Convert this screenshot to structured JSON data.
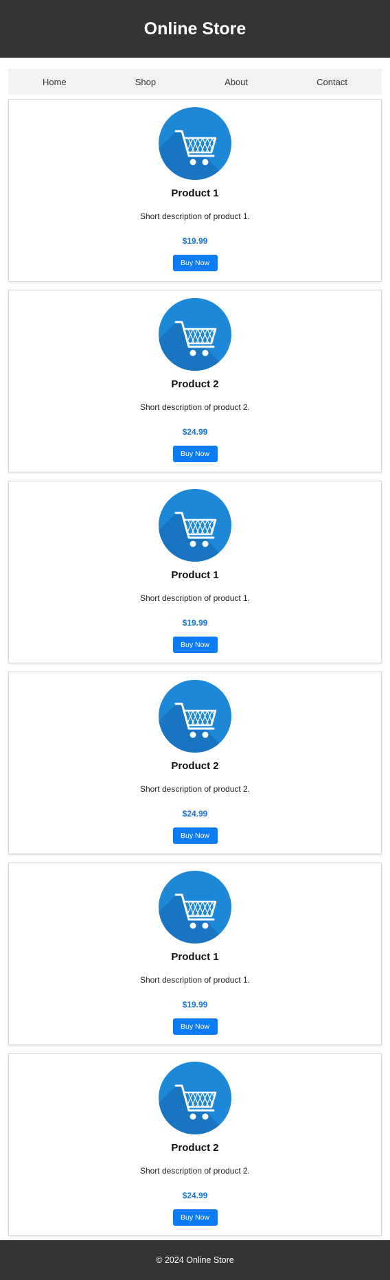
{
  "header": {
    "title": "Online Store"
  },
  "nav": {
    "items": [
      {
        "label": "Home"
      },
      {
        "label": "Shop"
      },
      {
        "label": "About"
      },
      {
        "label": "Contact"
      }
    ]
  },
  "products": [
    {
      "name": "Product 1",
      "description": "Short description of product 1.",
      "price": "$19.99",
      "button_label": "Buy Now",
      "icon": "shopping-cart-icon"
    },
    {
      "name": "Product 2",
      "description": "Short description of product 2.",
      "price": "$24.99",
      "button_label": "Buy Now",
      "icon": "shopping-cart-icon"
    },
    {
      "name": "Product 1",
      "description": "Short description of product 1.",
      "price": "$19.99",
      "button_label": "Buy Now",
      "icon": "shopping-cart-icon"
    },
    {
      "name": "Product 2",
      "description": "Short description of product 2.",
      "price": "$24.99",
      "button_label": "Buy Now",
      "icon": "shopping-cart-icon"
    },
    {
      "name": "Product 1",
      "description": "Short description of product 1.",
      "price": "$19.99",
      "button_label": "Buy Now",
      "icon": "shopping-cart-icon"
    },
    {
      "name": "Product 2",
      "description": "Short description of product 2.",
      "price": "$24.99",
      "button_label": "Buy Now",
      "icon": "shopping-cart-icon"
    }
  ],
  "footer": {
    "text": "© 2024 Online Store"
  },
  "colors": {
    "header_bg": "#333333",
    "accent": "#0d7bf2",
    "price": "#1a73d4",
    "icon_circle": "#1e88d8"
  }
}
